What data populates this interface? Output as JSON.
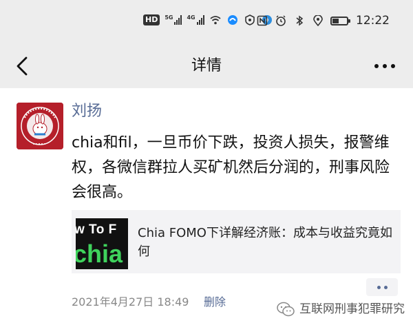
{
  "status_bar": {
    "hd_badge": "HD",
    "network_1": "5G",
    "network_2": "4G",
    "time": "12:22",
    "icons": [
      "hd-badge",
      "5g-signal-icon",
      "4g-signal-icon",
      "wifi-icon",
      "app-notification-icon",
      "shield-icon",
      "compass-icon",
      "nfc-icon",
      "alarm-icon",
      "bluetooth-icon",
      "location-icon",
      "battery-icon"
    ]
  },
  "nav": {
    "title": "详情",
    "back_icon": "chevron-left-icon",
    "more_icon": "more-dots-icon"
  },
  "post": {
    "author": "刘扬",
    "avatar_text": "PEKING UNIVERSITY 1898",
    "text": "chia和fil，一旦币价下跌，投资人损失，报警维权，各微信群拉人买矿机然后分润的，刑事风险会很高。",
    "link_card": {
      "thumb_line1": "w To F",
      "thumb_line2": "chia",
      "title": "Chia FOMO下详解经济账：成本与收益究竟如何"
    },
    "timestamp": "2021年4月27日 18:49",
    "delete_label": "删除"
  },
  "watermark": {
    "text": "互联网刑事犯罪研究"
  },
  "colors": {
    "bar_bg": "#ededed",
    "link_blue": "#576b95",
    "avatar_red": "#b51f2a",
    "chia_green": "#3fd35c"
  }
}
